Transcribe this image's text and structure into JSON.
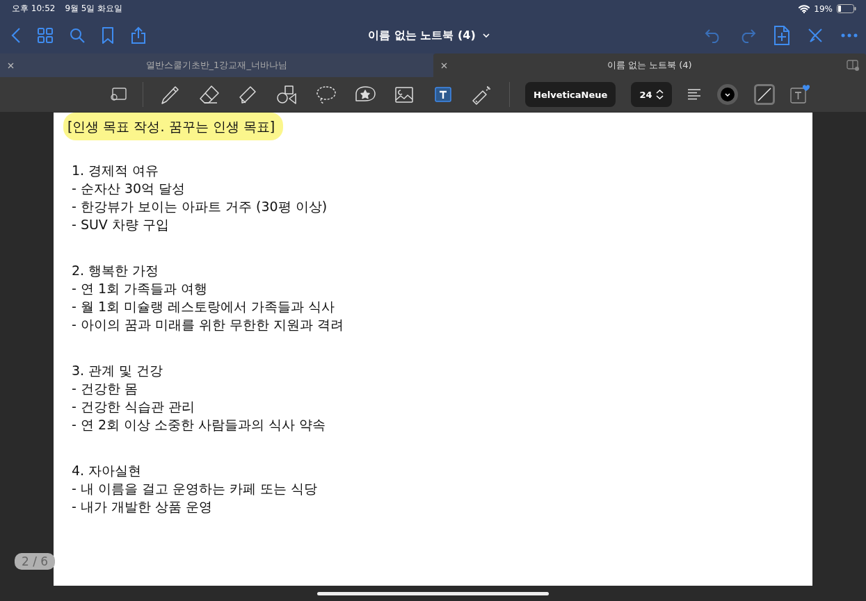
{
  "status_bar": {
    "time": "오후 10:52",
    "date": "9월 5일 화요일",
    "battery": "19%"
  },
  "nav_bar": {
    "title": "이름 없는 노트북 (4)"
  },
  "tabs": [
    {
      "label": "열반스쿨기초반_1강교재_너바나님",
      "selected": false
    },
    {
      "label": "이름 없는 노트북 (4)",
      "selected": true
    }
  ],
  "toolbar": {
    "tools": [
      {
        "kind": "pen",
        "selected": false
      },
      {
        "kind": "eraser",
        "selected": false
      },
      {
        "kind": "highlighter",
        "selected": false
      },
      {
        "kind": "shapes",
        "selected": false
      },
      {
        "kind": "lasso",
        "selected": false
      },
      {
        "kind": "sticker",
        "selected": false
      },
      {
        "kind": "image",
        "selected": false
      },
      {
        "kind": "text",
        "selected": true
      },
      {
        "kind": "laser",
        "selected": false
      }
    ],
    "font": "HelveticaNeue",
    "size": "24"
  },
  "page": {
    "title": "[인생 목표 작성. 꿈꾸는 인생 목표]",
    "title_highlighted": true,
    "sections": [
      {
        "heading": "1. 경제적 여유",
        "items": [
          "- 순자산 30억 달성",
          "- 한강뷰가 보이는 아파트 거주 (30평 이상)",
          "- SUV 차량 구입"
        ]
      },
      {
        "heading": "2. 행복한 가정",
        "items": [
          "- 연 1회 가족들과 여행",
          "- 월 1회 미슐랭 레스토랑에서 가족들과 식사",
          "- 아이의 꿈과 미래를 위한 무한한 지원과 격려"
        ]
      },
      {
        "heading": "3. 관계 및 건강",
        "items": [
          "- 건강한 몸",
          "- 건강한 식습관 관리",
          "- 연 2회 이상 소중한 사람들과의 식사 약속"
        ]
      },
      {
        "heading": "4. 자아실현",
        "items": [
          "- 내 이름을 걸고 운영하는 카페 또는 식당",
          "- 내가 개발한 상품 운영"
        ]
      }
    ]
  },
  "page_indicator": "2 / 6"
}
